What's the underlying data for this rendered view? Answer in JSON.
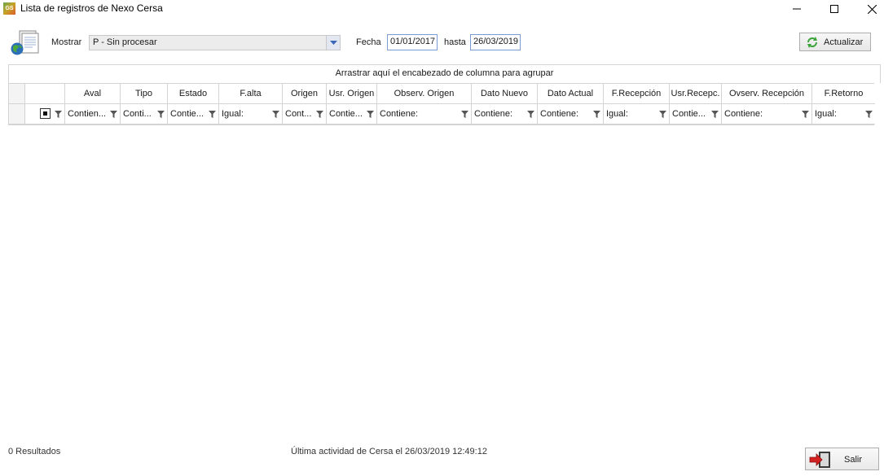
{
  "window": {
    "title": "Lista de registros de Nexo Cersa",
    "app_icon_text": "GS"
  },
  "filters": {
    "mostrar_label": "Mostrar",
    "mostrar_value": "P - Sin procesar",
    "fecha_label": "Fecha",
    "fecha_desde": "01/01/2017",
    "hasta_label": "hasta",
    "fecha_hasta": "26/03/2019",
    "actualizar_label": "Actualizar"
  },
  "grid": {
    "group_panel_text": "Arrastrar aquí el encabezado de columna para agrupar",
    "columns": [
      {
        "header": "Aval",
        "filter": "Contien..."
      },
      {
        "header": "Tipo",
        "filter": "Conti..."
      },
      {
        "header": "Estado",
        "filter": "Contie..."
      },
      {
        "header": "F.alta",
        "filter": "Igual:"
      },
      {
        "header": "Origen",
        "filter": "Cont..."
      },
      {
        "header": "Usr. Origen",
        "filter": "Contie..."
      },
      {
        "header": "Observ. Origen",
        "filter": "Contiene:"
      },
      {
        "header": "Dato Nuevo",
        "filter": "Contiene:"
      },
      {
        "header": "Dato Actual",
        "filter": "Contiene:"
      },
      {
        "header": "F.Recepción",
        "filter": "Igual:"
      },
      {
        "header": "Usr.Recepc.",
        "filter": "Contie..."
      },
      {
        "header": "Ovserv. Recepción",
        "filter": "Contiene:"
      },
      {
        "header": "F.Retorno",
        "filter": "Igual:"
      }
    ]
  },
  "footer": {
    "results": "0 Resultados",
    "activity": "Última actividad de Cersa el 26/03/2019 12:49:12",
    "salir_label": "Salir"
  }
}
